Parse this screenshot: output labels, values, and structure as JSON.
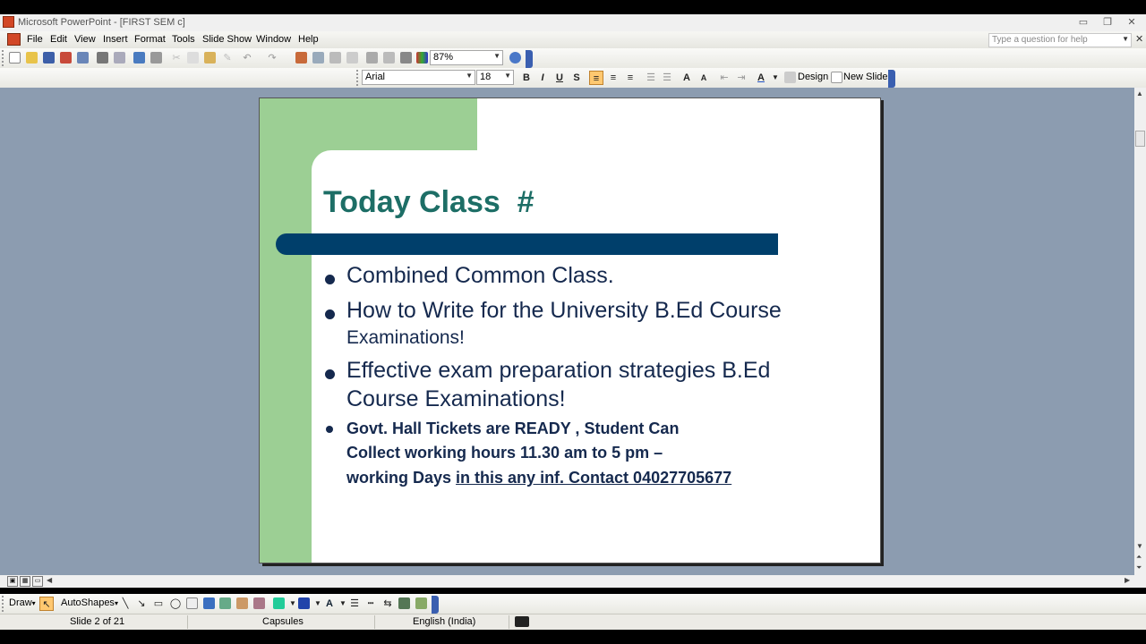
{
  "window": {
    "title": "Microsoft PowerPoint - [FIRST SEM c]"
  },
  "menu": {
    "items": [
      "File",
      "Edit",
      "View",
      "Insert",
      "Format",
      "Tools",
      "Slide Show",
      "Window",
      "Help"
    ],
    "help_placeholder": "Type a question for help"
  },
  "toolbar": {
    "zoom": "87%",
    "font": "Arial",
    "font_size": "18",
    "bold": "B",
    "italic": "I",
    "underline": "U",
    "shadow": "S",
    "design_label": "Design",
    "new_slide_label": "New Slide"
  },
  "slide": {
    "title": "Today Class  #",
    "bullets": [
      {
        "lines": [
          "Combined Common Class."
        ]
      },
      {
        "line1": "How to Write for the University B.Ed Course",
        "line2": "Examinations!"
      },
      {
        "line1": "Effective exam preparation strategies B.Ed",
        "line2": "Course Examinations!"
      },
      {
        "line1": "Govt. Hall Tickets are READY , Student Can",
        "line2": "Collect working hours 11.30 am to 5 pm –",
        "line3_plain": "working Days ",
        "line3_underlined": "in this  any inf. Contact  04027705677"
      }
    ]
  },
  "drawbar": {
    "draw_label": "Draw",
    "autoshapes_label": "AutoShapes"
  },
  "status": {
    "slide_counter": "Slide 2 of 21",
    "design": "Capsules",
    "language": "English (India)"
  },
  "colors": {
    "title": "#1d6e66",
    "body_text": "#15294e",
    "accent_bar": "#003f6b",
    "green_band": "#9ccf94",
    "workspace": "#8c9cb0"
  }
}
